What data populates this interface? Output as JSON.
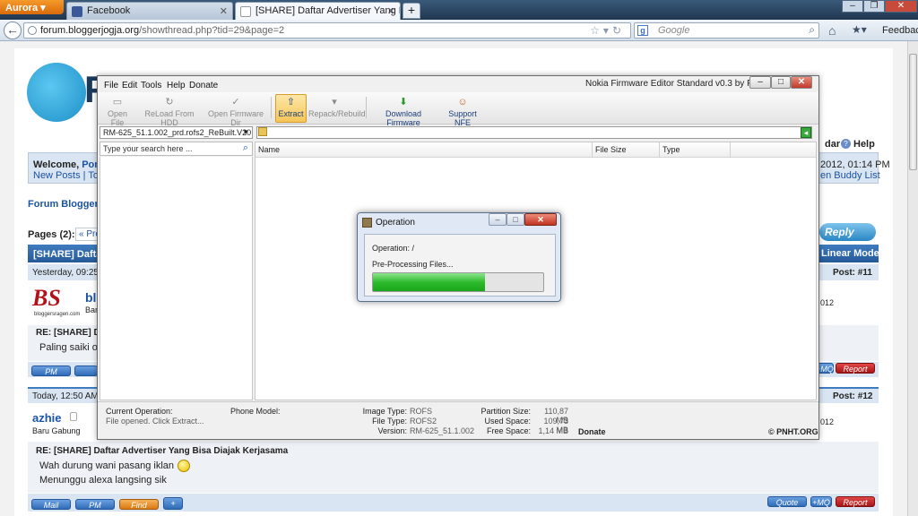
{
  "browser": {
    "app_button": "Aurora",
    "tabs": [
      {
        "label": "Facebook",
        "active": false
      },
      {
        "label": "[SHARE] Daftar Advertiser Yang Bisa ...",
        "active": true
      }
    ],
    "new_tab": "+",
    "url_host": "forum.bloggerjogja.org",
    "url_path": "/showthread.php?tid=29&page=2",
    "search_placeholder": "Google",
    "search_engine_letter": "g",
    "feedback": "Feedback"
  },
  "forum": {
    "logo_letter": "F",
    "nav_right": "dar",
    "help": "Help",
    "welcome": "Welcome,",
    "welcome_user": "Pond",
    "new_posts": "New Posts",
    "today": "Toda",
    "datetime": "2012, 01:14 PM",
    "buddy": "en Buddy List",
    "breadcrumb": "Forum Blogger",
    "pages": "Pages (2):",
    "prev": "« Pre",
    "reply": "Reply",
    "thread_title": "[SHARE] Dafta",
    "linear_mode": "Linear Mode",
    "post11": {
      "date": "Yesterday, 09:25",
      "number": "Post: #11",
      "user": "bl",
      "sub": "Bar",
      "joined": "012",
      "avatar_text": "BS",
      "avatar_sub": "bloggersragen.com",
      "subject": "RE: [SHARE] D",
      "body": "Paling saiki or",
      "btn_pm": "PM",
      "btn_mq": "+MQ",
      "btn_report": "Report"
    },
    "post12": {
      "date": "Today, 12:50 AM",
      "number": "Post: #12",
      "user": "azhie",
      "rank": "Baru Gabung",
      "joined": "012",
      "subject": "RE: [SHARE] Daftar Advertiser Yang Bisa Diajak Kerjasama",
      "body1": "Wah durung wani pasang iklan",
      "body2": "Menunggu alexa langsing sik",
      "btn_mail": "Mail",
      "btn_pm": "PM",
      "btn_find": "Find",
      "btn_quote": "Quote",
      "btn_mq": "+MQ",
      "btn_report": "Report"
    }
  },
  "app": {
    "title": "Nokia Firmware Editor Standard v0.3 by PNHT",
    "menu": [
      "File",
      "Edit",
      "Tools",
      "Help",
      "Donate"
    ],
    "tools": [
      {
        "label": "Open File",
        "enabled": false
      },
      {
        "label": "ReLoad From HDD",
        "enabled": false
      },
      {
        "label": "Open Firmware Dir",
        "enabled": false
      },
      {
        "label": "Extract",
        "enabled": true
      },
      {
        "label": "Repack/Rebuild",
        "enabled": false
      },
      {
        "label": "Download Firmware",
        "enabled": true
      },
      {
        "label": "Support NFE",
        "enabled": true
      }
    ],
    "firmware_select": "RM-625_51.1.002_prd.rofs2_ReBuilt.V20",
    "search_placeholder": "Type your search here ...",
    "columns": [
      "Name",
      "File Size",
      "Type"
    ],
    "status": {
      "current_op_label": "Current Operation:",
      "current_op_value": "File opened. Click Extract...",
      "phone_model_label": "Phone Model:",
      "image_type_label": "Image Type:",
      "image_type_value": "ROFS",
      "file_type_label": "File Type:",
      "file_type_value": "ROFS2",
      "version_label": "Version:",
      "version_value": "RM-625_51.1.002",
      "partition_label": "Partition Size:",
      "partition_value": "110,87 MB",
      "used_label": "Used Space:",
      "used_value": "109,73 MB",
      "free_label": "Free Space:",
      "free_value": "1,14 MB",
      "donate": "Donate",
      "copyright": "© PNHT.ORG"
    }
  },
  "dialog": {
    "title": "Operation",
    "operation_line": "Operation:  /",
    "status_line": "Pre-Processing Files...",
    "progress_percent": 66
  }
}
